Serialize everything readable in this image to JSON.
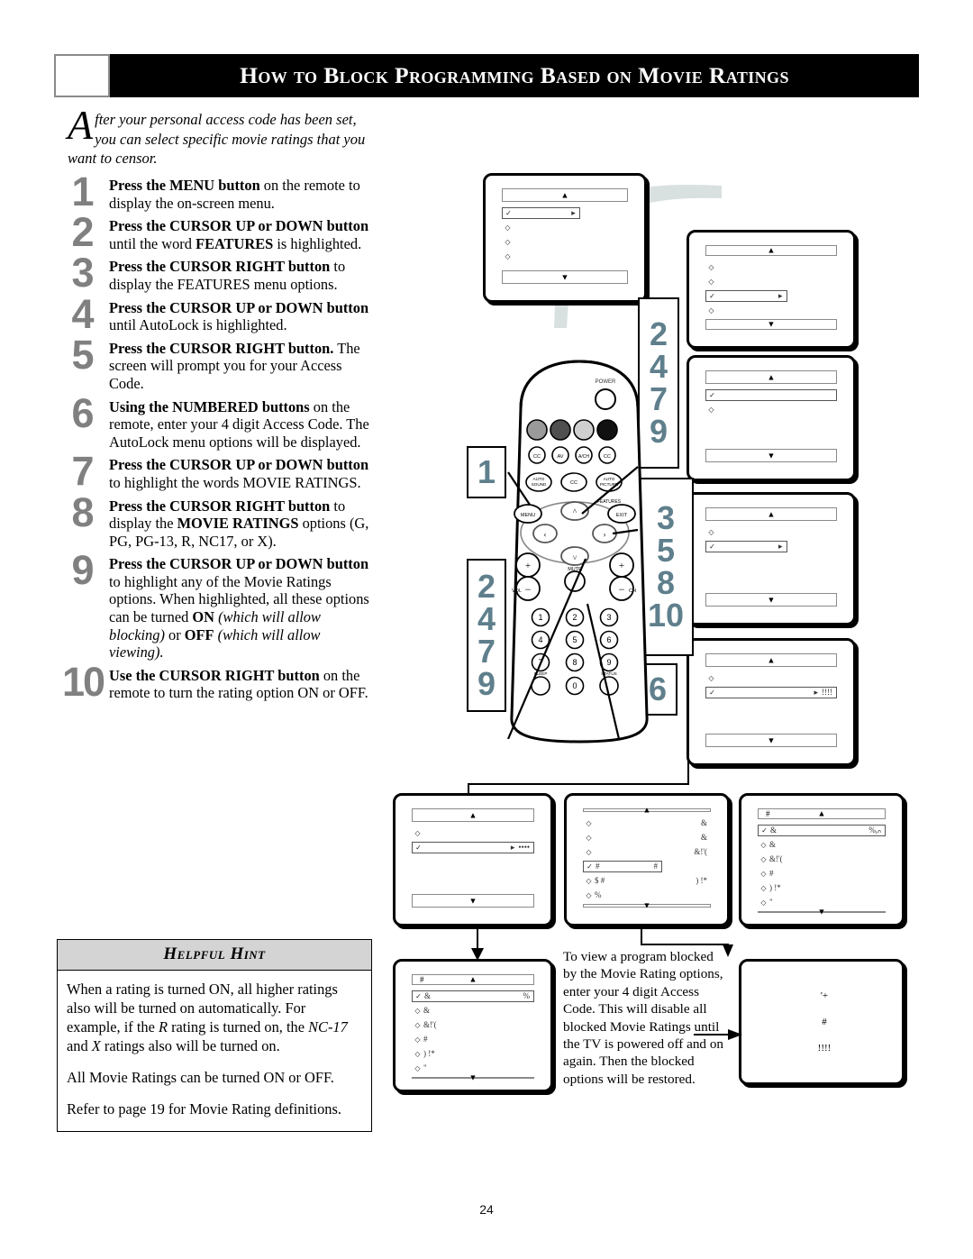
{
  "header": {
    "title": "How to Block Programming Based on Movie Ratings"
  },
  "intro": {
    "dropcap": "A",
    "text": "fter your personal access code has been set, you can select specific movie ratings that you want to censor."
  },
  "steps": [
    {
      "num": "1",
      "html": "<b>Press the MENU button</b> on the remote to display the on-screen menu."
    },
    {
      "num": "2",
      "html": "<b>Press the CURSOR UP or DOWN button</b> until the word <b>FEATURES</b> is highlighted."
    },
    {
      "num": "3",
      "html": "<b>Press the CURSOR RIGHT button</b> to display the FEATURES menu options."
    },
    {
      "num": "4",
      "html": "<b>Press the CURSOR UP or DOWN button</b> until AutoLock is highlighted."
    },
    {
      "num": "5",
      "html": "<b>Press the CURSOR RIGHT button.</b> The screen will prompt you for your Access Code."
    },
    {
      "num": "6",
      "html": "<b>Using the NUMBERED buttons</b> on the remote, enter your 4 digit Access Code. The AutoLock menu options will be displayed."
    },
    {
      "num": "7",
      "html": "<b>Press the CURSOR UP or DOWN button</b> to highlight the words MOVIE RATINGS."
    },
    {
      "num": "8",
      "html": "<b>Press the CURSOR RIGHT button</b> to display the <b>MOVIE RATINGS</b> options (G, PG, PG-13, R, NC17, or X)."
    },
    {
      "num": "9",
      "html": "<b>Press the CURSOR UP or DOWN button</b> to highlight any of the Movie Ratings options. When highlighted, all these options can be turned <b>ON</b> <i>(which will allow blocking)</i> or <b>OFF</b> <i>(which will allow viewing).</i>"
    },
    {
      "num": "10",
      "html": "<b>Use the CURSOR RIGHT button</b> on the remote to turn the rating option ON or OFF."
    }
  ],
  "hint": {
    "title": "Helpful Hint",
    "paragraphs": [
      "When a rating is turned ON, all higher ratings also will be turned on automatically.  For example, if the <i>R</i> rating is turned on, the <i>NC-17</i> and <i>X</i> ratings also will be turned on.",
      "All Movie Ratings can be turned ON or OFF.",
      "Refer to page 19 for Movie Rating definitions."
    ]
  },
  "note": {
    "text": "To view a program blocked by the Movie Rating options, enter your 4 digit Access Code. This will disable all blocked Movie Ratings until the TV is powered off and on again. Then the blocked options will be restored."
  },
  "callouts": [
    {
      "id": "callout-left-1",
      "lines": [
        "1"
      ]
    },
    {
      "id": "callout-left-2479",
      "lines": [
        "2",
        "4",
        "7",
        "9"
      ]
    },
    {
      "id": "callout-right-2479",
      "lines": [
        "2",
        "4",
        "7",
        "9"
      ]
    },
    {
      "id": "callout-right-35810",
      "lines": [
        "3",
        "5",
        "8",
        "10"
      ]
    },
    {
      "id": "callout-right-6",
      "lines": [
        "6"
      ]
    }
  ],
  "remote": {
    "power_label": "POWER",
    "color_keys": [
      "",
      "",
      "",
      ""
    ],
    "icon_row": [
      "CC",
      "AV",
      "A/CH",
      "CC"
    ],
    "fn_row": [
      "AUTO SOUND",
      "CC",
      "AUTO PICTURE"
    ],
    "menu_label": "MENU",
    "exit_label": "EXIT",
    "features_label": "FEATURES",
    "mute_label": "MUTE",
    "vol_label": "VOL",
    "ch_label": "CH",
    "numbers": [
      "1",
      "2",
      "3",
      "4",
      "5",
      "6",
      "7",
      "8",
      "9",
      "0"
    ],
    "sleep_label": "SLEEP",
    "status_label": "STATUS"
  },
  "tv_screens": [
    {
      "id": "screen-main-menu",
      "rows": [
        {
          "bullet": "✓",
          "label": "",
          "right": "▸",
          "selected": "box"
        },
        {
          "bullet": "◇",
          "label": "",
          "right": ""
        },
        {
          "bullet": "◇",
          "label": "",
          "right": ""
        },
        {
          "bullet": "◇",
          "label": "",
          "right": ""
        }
      ]
    },
    {
      "id": "screen-features-highlight",
      "rows": [
        {
          "bullet": "◇",
          "label": "",
          "right": ""
        },
        {
          "bullet": "◇",
          "label": "",
          "right": ""
        },
        {
          "bullet": "✓",
          "label": "",
          "right": "▸",
          "selected": "box"
        },
        {
          "bullet": "◇",
          "label": "",
          "right": ""
        }
      ]
    },
    {
      "id": "screen-features-menu",
      "rows": [
        {
          "bullet": "✓",
          "label": "",
          "right": "",
          "selected": "full"
        },
        {
          "bullet": "◇",
          "label": "",
          "right": ""
        }
      ]
    },
    {
      "id": "screen-autolock-highlight",
      "rows": [
        {
          "bullet": "◇",
          "label": "",
          "right": ""
        },
        {
          "bullet": "✓",
          "label": "",
          "right": "▸",
          "selected": "box"
        }
      ]
    },
    {
      "id": "screen-access-prompt",
      "rows": [
        {
          "bullet": "◇",
          "label": "",
          "right": ""
        },
        {
          "bullet": "✓",
          "label": "",
          "right": "▸",
          "extra": "!!!!",
          "selected": "full"
        }
      ]
    },
    {
      "id": "screen-autolock-options",
      "rows": [
        {
          "bullet": "◇",
          "label": "",
          "right": ""
        },
        {
          "bullet": "✓",
          "label": "",
          "right": "▸",
          "extra": "••••",
          "selected": "full"
        }
      ]
    },
    {
      "id": "screen-autolock-list",
      "rows": [
        {
          "bullet": "◇",
          "label": "",
          "right": "&"
        },
        {
          "bullet": "◇",
          "label": "",
          "right": "&"
        },
        {
          "bullet": "◇",
          "label": "",
          "right": "&!'("
        },
        {
          "bullet": "✓",
          "label": "#",
          "right": "#",
          "selected": "box"
        },
        {
          "bullet": "◇",
          "label": "$ #",
          "right": ") !*"
        },
        {
          "bullet": "◇",
          "label": "%",
          "right": ""
        }
      ]
    },
    {
      "id": "screen-movie-ratings-1",
      "title": "#",
      "rows": [
        {
          "bullet": "✓",
          "label": "&",
          "right": "%ₒₙ",
          "selected": "full"
        },
        {
          "bullet": "◇",
          "label": "&",
          "right": ""
        },
        {
          "bullet": "◇",
          "label": "&!'(",
          "right": ""
        },
        {
          "bullet": "◇",
          "label": "#",
          "right": ""
        },
        {
          "bullet": "◇",
          "label": ") !*",
          "right": ""
        },
        {
          "bullet": "◇",
          "label": "\"",
          "right": ""
        }
      ]
    },
    {
      "id": "screen-movie-ratings-2",
      "title": "#",
      "rows": [
        {
          "bullet": "✓",
          "label": "&",
          "right": "%",
          "selected": "full"
        },
        {
          "bullet": "◇",
          "label": "&",
          "right": ""
        },
        {
          "bullet": "◇",
          "label": "&!'(",
          "right": ""
        },
        {
          "bullet": "◇",
          "label": "#",
          "right": ""
        },
        {
          "bullet": "◇",
          "label": ") !*",
          "right": ""
        },
        {
          "bullet": "◇",
          "label": "\"",
          "right": ""
        }
      ]
    },
    {
      "id": "screen-access-code-entry",
      "free_lines": [
        "'+",
        "#",
        "!!!!"
      ]
    }
  ],
  "page": {
    "number": "24"
  }
}
